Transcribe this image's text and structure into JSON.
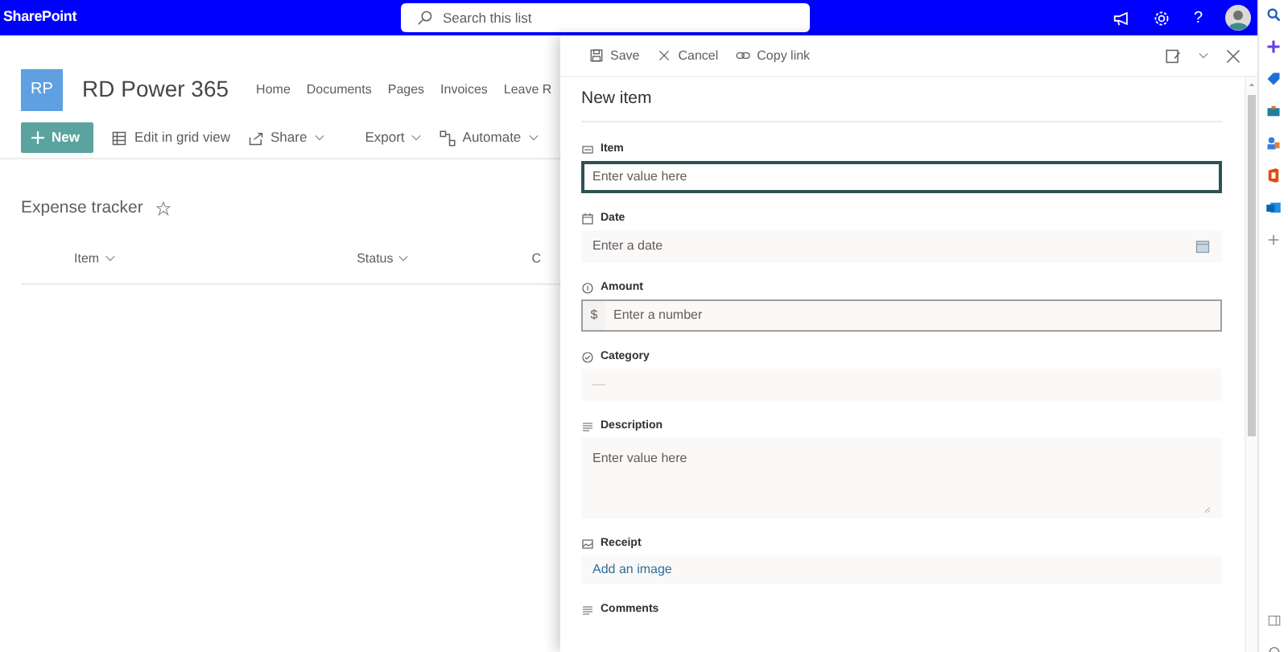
{
  "app": {
    "name": "SharePoint"
  },
  "search": {
    "placeholder": "Search this list"
  },
  "help": "?",
  "site": {
    "initials": "RP",
    "title": "RD Power 365",
    "nav": [
      "Home",
      "Documents",
      "Pages",
      "Invoices",
      "Leave R"
    ]
  },
  "commands": [
    {
      "label": "New",
      "kind": "primary"
    },
    {
      "label": "Edit in grid view",
      "kind": "grid"
    },
    {
      "label": "Share",
      "kind": "share"
    },
    {
      "label": "Export",
      "kind": "menu"
    },
    {
      "label": "Automate",
      "kind": "automate"
    }
  ],
  "list": {
    "title": "Expense tracker",
    "favorite": false,
    "columns": [
      {
        "label": "Item",
        "sortable": true
      },
      {
        "label": "Status",
        "sortable": true
      },
      {
        "label": "C",
        "sortable": false
      }
    ]
  },
  "panel": {
    "toolbar": [
      {
        "label": "Save",
        "kind": "save"
      },
      {
        "label": "Cancel",
        "kind": "cancel"
      },
      {
        "label": "Copy link",
        "kind": "link"
      }
    ],
    "title": "New item",
    "fields": [
      {
        "label": "Item",
        "kind": "text",
        "placeholder": "Enter value here",
        "focused": true
      },
      {
        "label": "Date",
        "kind": "date",
        "placeholder": "Enter a date",
        "focused": false
      },
      {
        "label": "Amount",
        "kind": "currency",
        "prefix": "$",
        "placeholder": "Enter a number",
        "focused": false
      },
      {
        "label": "Category",
        "kind": "choice",
        "value": "—",
        "focused": false
      },
      {
        "label": "Description",
        "kind": "multiline",
        "placeholder": "Enter value here",
        "focused": false
      },
      {
        "label": "Receipt",
        "kind": "image",
        "link": "Add an image",
        "focused": false
      },
      {
        "label": "Comments",
        "kind": "comments"
      }
    ]
  }
}
